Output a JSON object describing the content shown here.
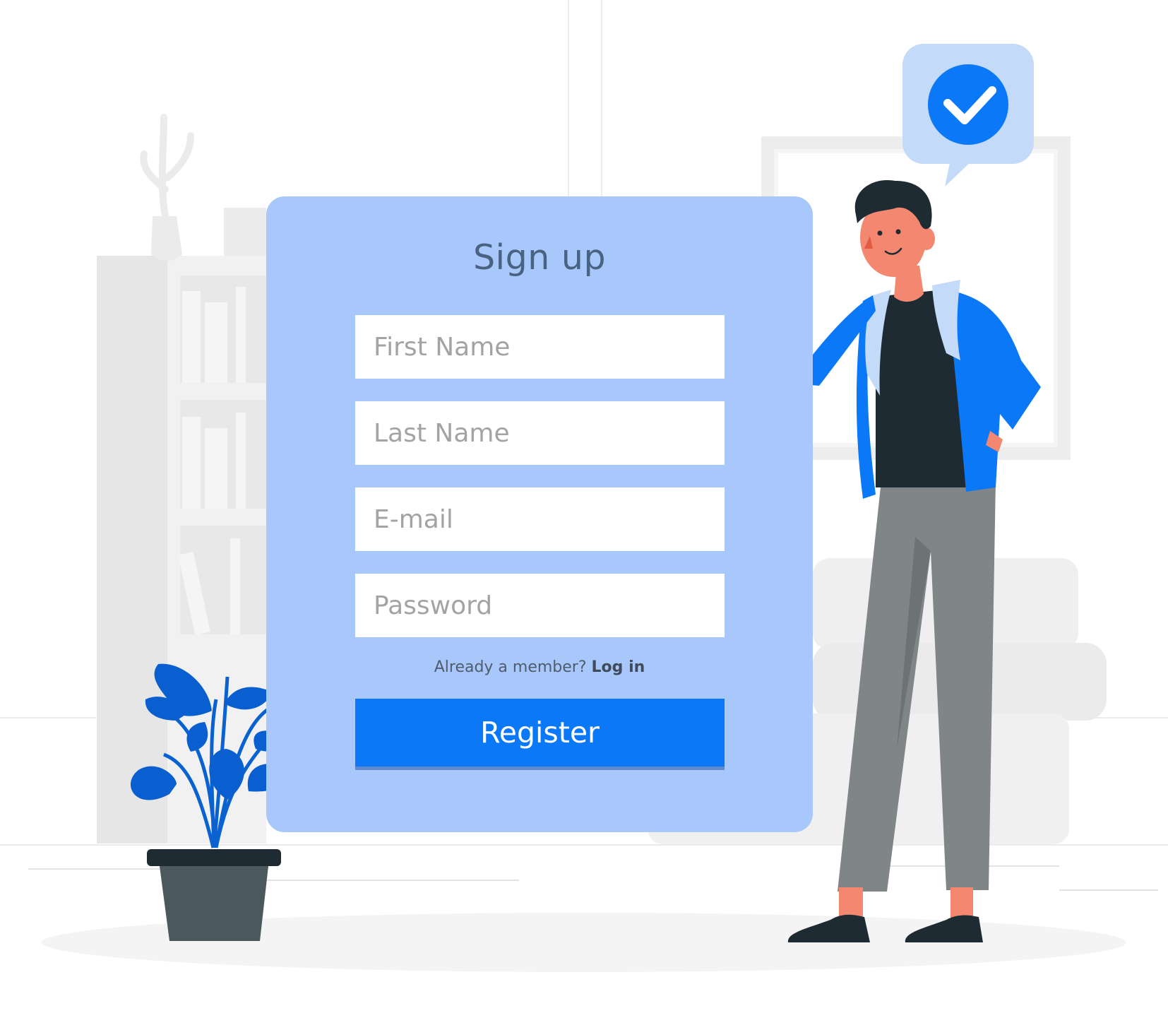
{
  "form": {
    "title": "Sign up",
    "fields": [
      {
        "placeholder": "First Name",
        "value": ""
      },
      {
        "placeholder": "Last Name",
        "value": ""
      },
      {
        "placeholder": "E-mail",
        "value": ""
      },
      {
        "placeholder": "Password",
        "value": ""
      }
    ],
    "member_prompt": "Already a member?",
    "login_link": "Log in",
    "register_label": "Register"
  },
  "colors": {
    "card": "#a8c8fb",
    "accent": "#0a78f7",
    "title": "#4a6282",
    "placeholder": "#a3a3a3"
  },
  "illustration": {
    "badge_icon": "check-circle-icon"
  }
}
